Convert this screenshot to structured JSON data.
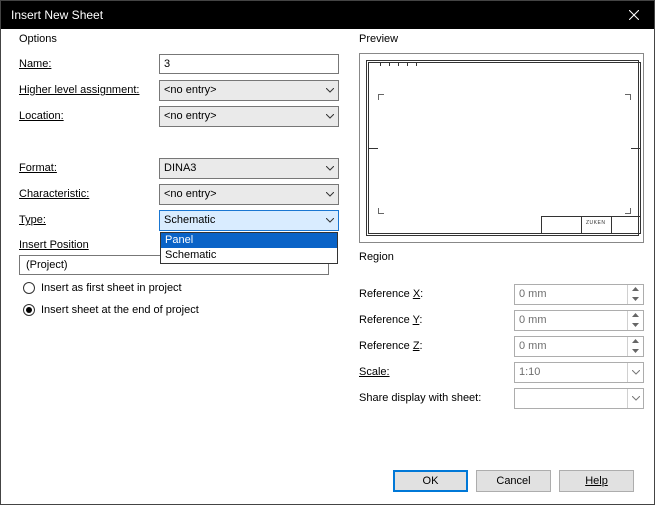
{
  "window": {
    "title": "Insert New Sheet"
  },
  "options": {
    "group_label": "Options",
    "name_label": "Name:",
    "name_value": "3",
    "higher_label": "Higher level assignment:",
    "higher_value": "<no entry>",
    "location_label": "Location:",
    "location_value": "<no entry>",
    "format_label": "Format:",
    "format_value": "DINA3",
    "characteristic_label": "Characteristic:",
    "characteristic_value": "<no entry>",
    "type_label": "Type:",
    "type_value": "Schematic",
    "type_options": {
      "panel": "Panel",
      "schematic": "Schematic"
    }
  },
  "insert_position": {
    "label": "Insert Position",
    "project_value": "(Project)",
    "radio_first": "Insert as first sheet in project",
    "radio_end": "Insert sheet at the end of project"
  },
  "preview": {
    "group_label": "Preview",
    "titleblock_text": "ZUKEN"
  },
  "region": {
    "group_label": "Region",
    "ref_x_prefix": "Reference ",
    "ref_x_u": "X",
    "ref_x_suffix": ":",
    "ref_x_value": "0 mm",
    "ref_y_prefix": "Reference ",
    "ref_y_u": "Y",
    "ref_y_suffix": ":",
    "ref_y_value": "0 mm",
    "ref_z_prefix": "Reference ",
    "ref_z_u": "Z",
    "ref_z_suffix": ":",
    "ref_z_value": "0 mm",
    "scale_label": "Scale:",
    "scale_value": "1:10",
    "share_label": "Share display with sheet:",
    "share_value": ""
  },
  "buttons": {
    "ok": "OK",
    "cancel": "Cancel",
    "help": "Help"
  }
}
